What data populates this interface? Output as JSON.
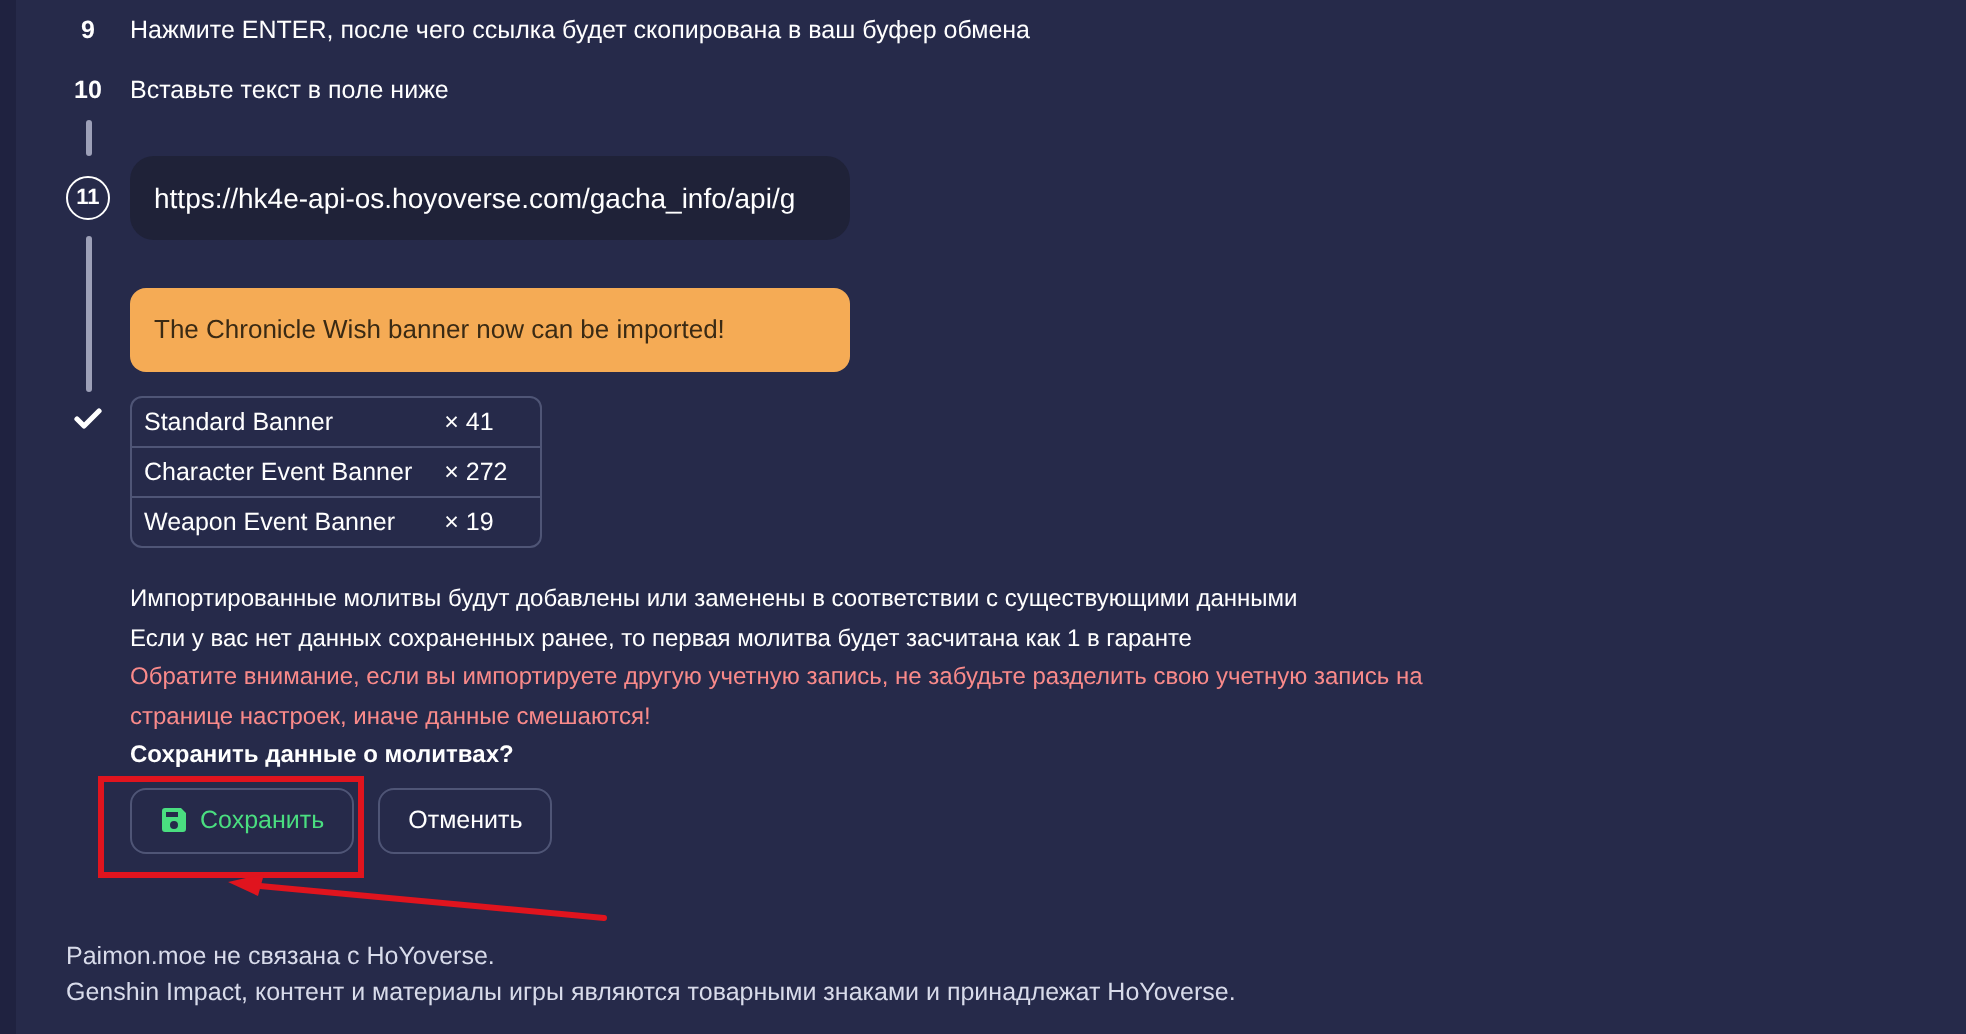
{
  "steps": [
    {
      "number": "9",
      "text": "Нажмите ENTER, после чего ссылка будет скопирована в ваш буфер обмена"
    },
    {
      "number": "10",
      "text": "Вставьте текст в поле ниже"
    }
  ],
  "url_step": {
    "number": "11",
    "value": "https://hk4e-api-os.hoyoverse.com/gacha_info/api/g"
  },
  "notice": "The Chronicle Wish banner now can be imported!",
  "banners": [
    {
      "name": "Standard Banner",
      "count": "× 41"
    },
    {
      "name": "Character Event Banner",
      "count": "× 272"
    },
    {
      "name": "Weapon Event Banner",
      "count": "× 19"
    }
  ],
  "info": [
    "Импортированные молитвы будут добавлены или заменены в соответствии с существующими данными",
    "Если у вас нет данных сохраненных ранее, то первая молитва будет засчитана как 1 в гаранте"
  ],
  "warning": "Обратите внимание, если вы импортируете другую учетную запись, не забудьте разделить свою учетную запись на странице настроек, иначе данные смешаются!",
  "question": "Сохранить данные о молитвах?",
  "buttons": [
    {
      "label": "Сохранить",
      "kind": "primary"
    },
    {
      "label": "Отменить",
      "kind": "secondary"
    }
  ],
  "footer": [
    "Paimon.moe не связана с HoYoverse.",
    "Genshin Impact, контент и материалы игры являются товарными знаками и принадлежат HoYoverse."
  ]
}
